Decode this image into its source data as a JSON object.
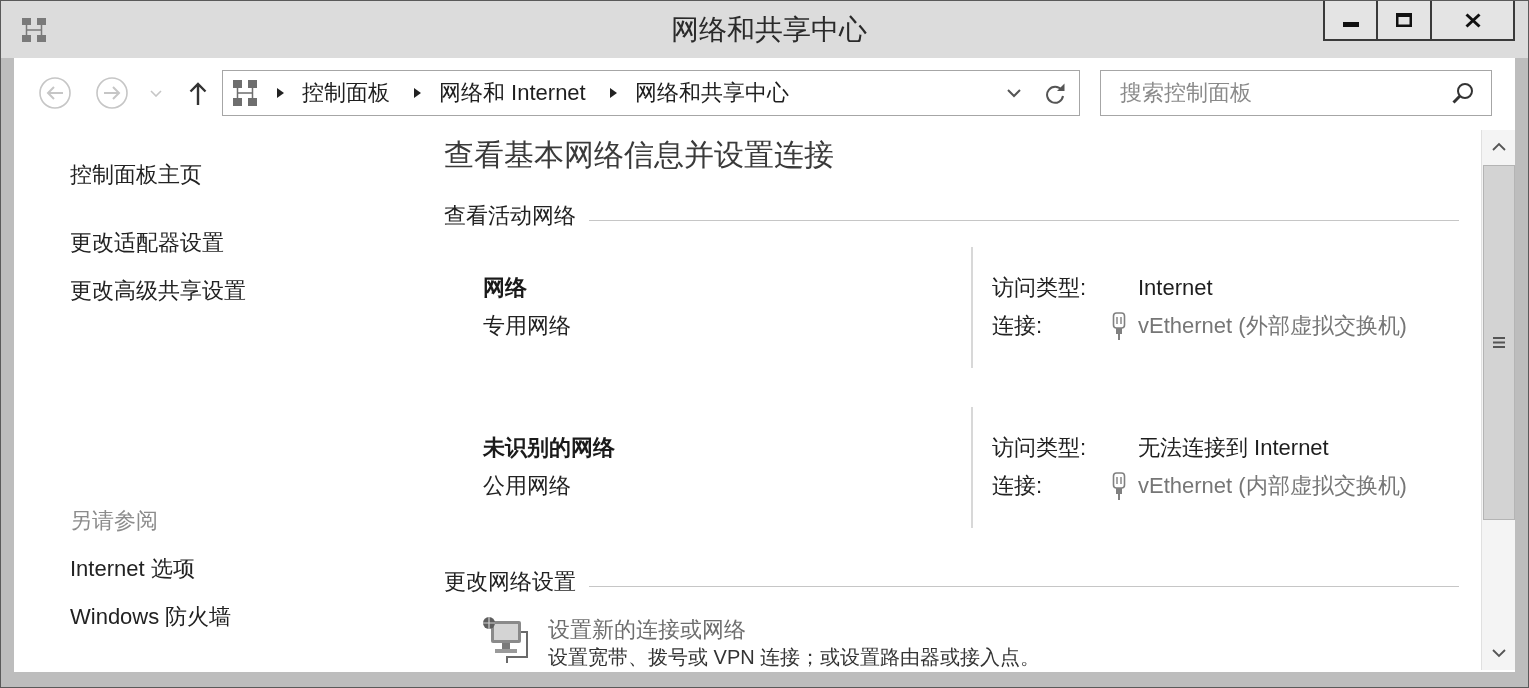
{
  "window": {
    "title": "网络和共享中心"
  },
  "navigation": [
    {
      "kind": "back",
      "disabled": true
    },
    {
      "kind": "forward",
      "disabled": true
    },
    {
      "kind": "recent",
      "disabled": true
    },
    {
      "kind": "up",
      "disabled": false
    }
  ],
  "address_bar": {
    "breadcrumbs": [
      "控制面板",
      "网络和 Internet",
      "网络和共享中心"
    ]
  },
  "search": {
    "placeholder": "搜索控制面板"
  },
  "sidebar": {
    "home": "控制面板主页",
    "tasks": [
      "更改适配器设置",
      "更改高级共享设置"
    ],
    "see_also": {
      "title": "另请参阅",
      "items": [
        "Internet 选项",
        "Windows 防火墙"
      ]
    }
  },
  "main": {
    "heading": "查看基本网络信息并设置连接",
    "active_networks": {
      "title": "查看活动网络",
      "networks": [
        {
          "name": "网络",
          "category": "专用网络",
          "access_label": "访问类型:",
          "access": "Internet",
          "connection_label": "连接:",
          "connection": "vEthernet (外部虚拟交换机)"
        },
        {
          "name": "未识别的网络",
          "category": "公用网络",
          "access_label": "访问类型:",
          "access": "无法连接到 Internet",
          "connection_label": "连接:",
          "connection": "vEthernet (内部虚拟交换机)"
        }
      ]
    },
    "change_settings": {
      "title": "更改网络设置",
      "tasks": [
        {
          "title": "设置新的连接或网络",
          "description": "设置宽带、拨号或 VPN 连接；或设置路由器或接入点。"
        }
      ]
    }
  }
}
